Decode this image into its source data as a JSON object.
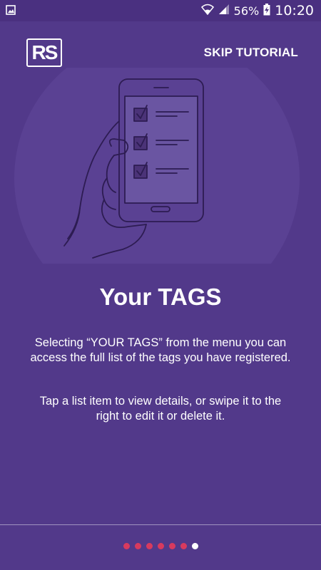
{
  "statusbar": {
    "left_icon": "image-icon",
    "wifi_icon": "wifi-icon",
    "signal_icon": "signal-icon",
    "battery_percent": "56%",
    "battery_icon": "battery-charging-icon",
    "time": "10:20"
  },
  "header": {
    "logo_text": "RS",
    "skip_label": "SKIP TUTORIAL"
  },
  "illustration": {
    "icon": "hand-holding-phone-checklist-icon"
  },
  "content": {
    "title": "Your TAGS",
    "paragraph1": "Selecting “YOUR TAGS” from the menu you can access the full list of the tags you have registered.",
    "paragraph2": "Tap a list item to view details, or swipe it to the right to edit it or delete it."
  },
  "pager": {
    "total": 7,
    "active_index": 6
  },
  "colors": {
    "background": "#52398a",
    "statusbar": "#4a3080",
    "dot": "#d83a5e",
    "dot_active": "#ffffff"
  }
}
